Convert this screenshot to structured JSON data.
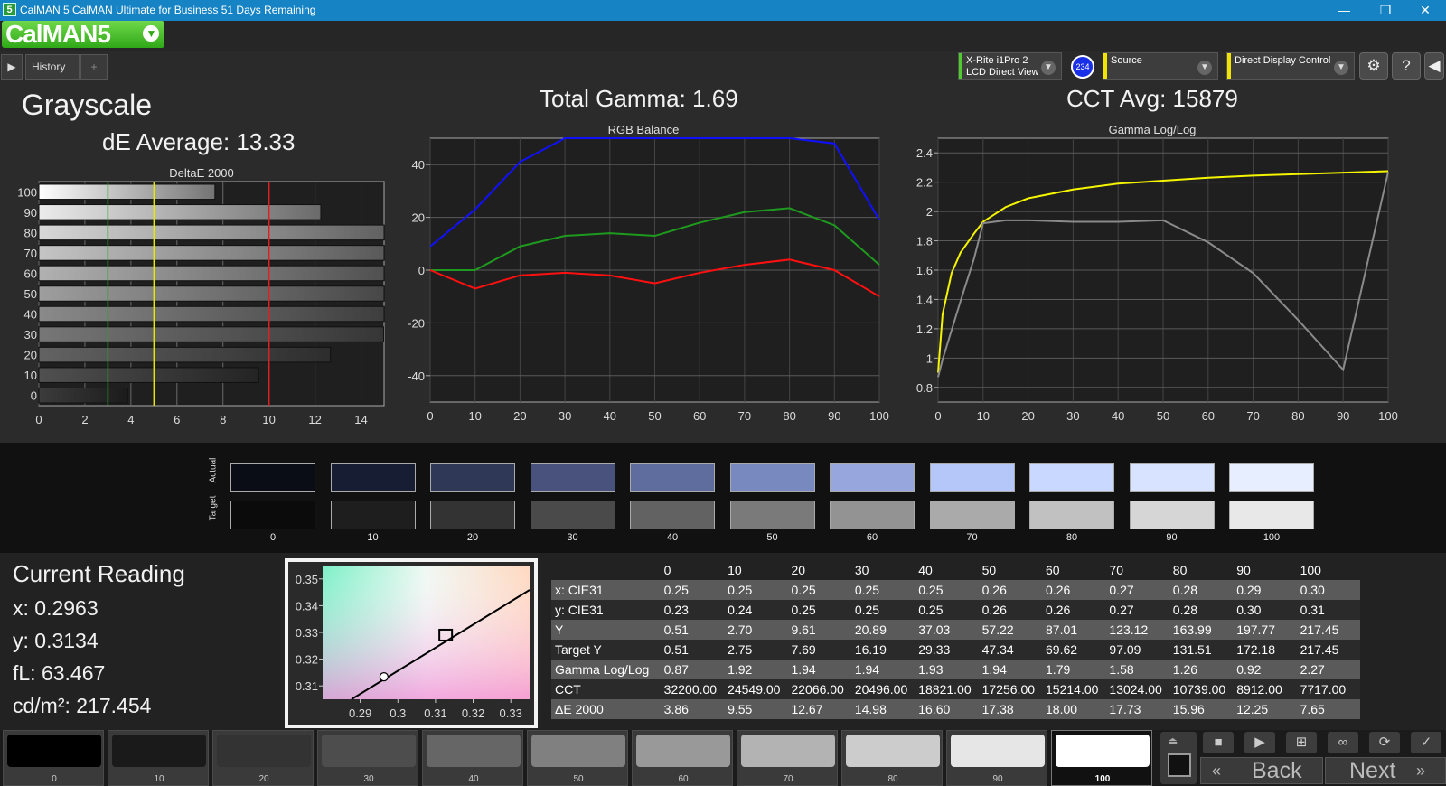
{
  "window": {
    "title": "CalMAN 5 CalMAN Ultimate for Business 51 Days Remaining",
    "app_icon": "5",
    "minimize": "—",
    "maximize": "❐",
    "close": "✕"
  },
  "brand": {
    "logo": "CalMAN5"
  },
  "tabs": [
    {
      "label": "History 1"
    }
  ],
  "toolbar": {
    "meter": {
      "line1": "X-Rite i1Pro 2",
      "line2": "LCD Direct View",
      "badge": "234"
    },
    "source": {
      "label": "Source"
    },
    "display": {
      "label": "Direct Display Control"
    }
  },
  "page": {
    "title": "Grayscale",
    "de_average": "dE Average: 13.33",
    "total_gamma": "Total Gamma: 1.69",
    "cct_avg": "CCT Avg: 15879"
  },
  "chart_data": [
    {
      "type": "bar",
      "title": "DeltaE 2000",
      "orientation": "horizontal",
      "categories": [
        "100",
        "90",
        "80",
        "70",
        "60",
        "50",
        "40",
        "30",
        "20",
        "10",
        "0"
      ],
      "values": [
        7.65,
        12.25,
        15.96,
        17.73,
        18.0,
        17.38,
        16.6,
        14.98,
        12.67,
        9.55,
        3.86
      ],
      "xlim": [
        0,
        15
      ],
      "xticks": [
        0,
        2,
        4,
        6,
        8,
        10,
        12,
        14
      ],
      "reference_lines": [
        {
          "value": 3,
          "color": "#22a822"
        },
        {
          "value": 5,
          "color": "#e8e800"
        },
        {
          "value": 10,
          "color": "#e02020"
        }
      ],
      "grid": true
    },
    {
      "type": "line",
      "title": "RGB Balance",
      "x": [
        0,
        10,
        20,
        30,
        40,
        50,
        60,
        70,
        80,
        90,
        100
      ],
      "series": [
        {
          "color": "#1010ff",
          "values": [
            9,
            23,
            41,
            50,
            50,
            50,
            50,
            50,
            50,
            48,
            19
          ]
        },
        {
          "color": "#1e9a1e",
          "values": [
            0,
            0,
            9,
            13,
            14,
            13,
            18,
            22,
            23.5,
            17,
            2
          ]
        },
        {
          "color": "#ff1010",
          "values": [
            0,
            -7,
            -2,
            -1,
            -2,
            -5,
            -1,
            2,
            4,
            0,
            -10
          ]
        }
      ],
      "xlim": [
        0,
        100
      ],
      "ylim": [
        -50,
        50
      ],
      "xticks": [
        0,
        10,
        20,
        30,
        40,
        50,
        60,
        70,
        80,
        90,
        100
      ],
      "yticks": [
        40,
        20,
        0,
        -20,
        -40
      ],
      "grid": true
    },
    {
      "type": "line",
      "title": "Gamma Log/Log",
      "x": [
        0,
        1,
        3,
        5,
        8,
        10,
        15,
        20,
        30,
        40,
        50,
        60,
        70,
        80,
        90,
        100
      ],
      "series": [
        {
          "color": "#f5f500",
          "values": [
            0.9,
            1.3,
            1.58,
            1.72,
            1.85,
            1.93,
            2.03,
            2.09,
            2.15,
            2.19,
            2.21,
            2.23,
            2.245,
            2.255,
            2.265,
            2.275
          ]
        },
        {
          "color": "#8a8a8a",
          "values": [
            0.87,
            0.99,
            1.19,
            1.39,
            1.68,
            1.92,
            1.94,
            1.94,
            1.93,
            1.93,
            1.94,
            1.79,
            1.58,
            1.26,
            0.92,
            2.27
          ]
        }
      ],
      "xlim": [
        0,
        100
      ],
      "ylim": [
        0.7,
        2.5
      ],
      "xticks": [
        0,
        10,
        20,
        30,
        40,
        50,
        60,
        70,
        80,
        90,
        100
      ],
      "yticks": [
        2.4,
        2.2,
        2,
        1.8,
        1.6,
        1.4,
        1.2,
        1,
        0.8
      ],
      "grid": true
    },
    {
      "type": "scatter",
      "title": "",
      "points": [
        {
          "x": 0.2963,
          "y": 0.3134,
          "shape": "circle"
        },
        {
          "x": 0.3127,
          "y": 0.329,
          "shape": "square"
        }
      ],
      "xlim": [
        0.28,
        0.335
      ],
      "ylim": [
        0.305,
        0.355
      ],
      "xticks": [
        0.29,
        0.3,
        0.31,
        0.32,
        0.33
      ],
      "yticks": [
        0.35,
        0.34,
        0.33,
        0.32,
        0.31
      ]
    }
  ],
  "swatches": {
    "actual_label": "Actual",
    "target_label": "Target",
    "steps": [
      {
        "label": "0",
        "actual": "#0a0c16",
        "target": "#0b0b0b"
      },
      {
        "label": "10",
        "actual": "#171d33",
        "target": "#1e1e1e"
      },
      {
        "label": "20",
        "actual": "#2f3857",
        "target": "#333333"
      },
      {
        "label": "30",
        "actual": "#48527d",
        "target": "#4a4a4a"
      },
      {
        "label": "40",
        "actual": "#5f6c9e",
        "target": "#626262"
      },
      {
        "label": "50",
        "actual": "#7889c0",
        "target": "#7a7a7a"
      },
      {
        "label": "60",
        "actual": "#97a6dc",
        "target": "#939393"
      },
      {
        "label": "70",
        "actual": "#b5c6f8",
        "target": "#aaaaaa"
      },
      {
        "label": "80",
        "actual": "#c8d8ff",
        "target": "#c1c1c1"
      },
      {
        "label": "90",
        "actual": "#d8e4ff",
        "target": "#d6d6d6"
      },
      {
        "label": "100",
        "actual": "#e6eeff",
        "target": "#e8e8e8"
      }
    ]
  },
  "reading": {
    "title": "Current Reading",
    "x": "x: 0.2963",
    "y": "y: 0.3134",
    "fl": "fL: 63.467",
    "cdm2": "cd/m²: 217.454"
  },
  "table": {
    "columns": [
      "",
      "0",
      "10",
      "20",
      "30",
      "40",
      "50",
      "60",
      "70",
      "80",
      "90",
      "100"
    ],
    "rows": [
      [
        "x: CIE31",
        "0.25",
        "0.25",
        "0.25",
        "0.25",
        "0.25",
        "0.26",
        "0.26",
        "0.27",
        "0.28",
        "0.29",
        "0.30"
      ],
      [
        "y: CIE31",
        "0.23",
        "0.24",
        "0.25",
        "0.25",
        "0.25",
        "0.26",
        "0.26",
        "0.27",
        "0.28",
        "0.30",
        "0.31"
      ],
      [
        "Y",
        "0.51",
        "2.70",
        "9.61",
        "20.89",
        "37.03",
        "57.22",
        "87.01",
        "123.12",
        "163.99",
        "197.77",
        "217.45"
      ],
      [
        "Target Y",
        "0.51",
        "2.75",
        "7.69",
        "16.19",
        "29.33",
        "47.34",
        "69.62",
        "97.09",
        "131.51",
        "172.18",
        "217.45"
      ],
      [
        "Gamma Log/Log",
        "0.87",
        "1.92",
        "1.94",
        "1.94",
        "1.93",
        "1.94",
        "1.79",
        "1.58",
        "1.26",
        "0.92",
        "2.27"
      ],
      [
        "CCT",
        "32200.00",
        "24549.00",
        "22066.00",
        "20496.00",
        "18821.00",
        "17256.00",
        "15214.00",
        "13024.00",
        "10739.00",
        "8912.00",
        "7717.00"
      ],
      [
        "ΔE 2000",
        "3.86",
        "9.55",
        "12.67",
        "14.98",
        "16.60",
        "17.38",
        "18.00",
        "17.73",
        "15.96",
        "12.25",
        "7.65"
      ]
    ]
  },
  "steps": [
    {
      "label": "0",
      "color": "#000000"
    },
    {
      "label": "10",
      "color": "#1a1a1a"
    },
    {
      "label": "20",
      "color": "#333333"
    },
    {
      "label": "30",
      "color": "#4d4d4d"
    },
    {
      "label": "40",
      "color": "#666666"
    },
    {
      "label": "50",
      "color": "#808080"
    },
    {
      "label": "60",
      "color": "#999999"
    },
    {
      "label": "70",
      "color": "#b3b3b3"
    },
    {
      "label": "80",
      "color": "#cccccc"
    },
    {
      "label": "90",
      "color": "#e6e6e6"
    },
    {
      "label": "100",
      "color": "#ffffff"
    }
  ],
  "nav": {
    "back": "Back",
    "next": "Next"
  }
}
